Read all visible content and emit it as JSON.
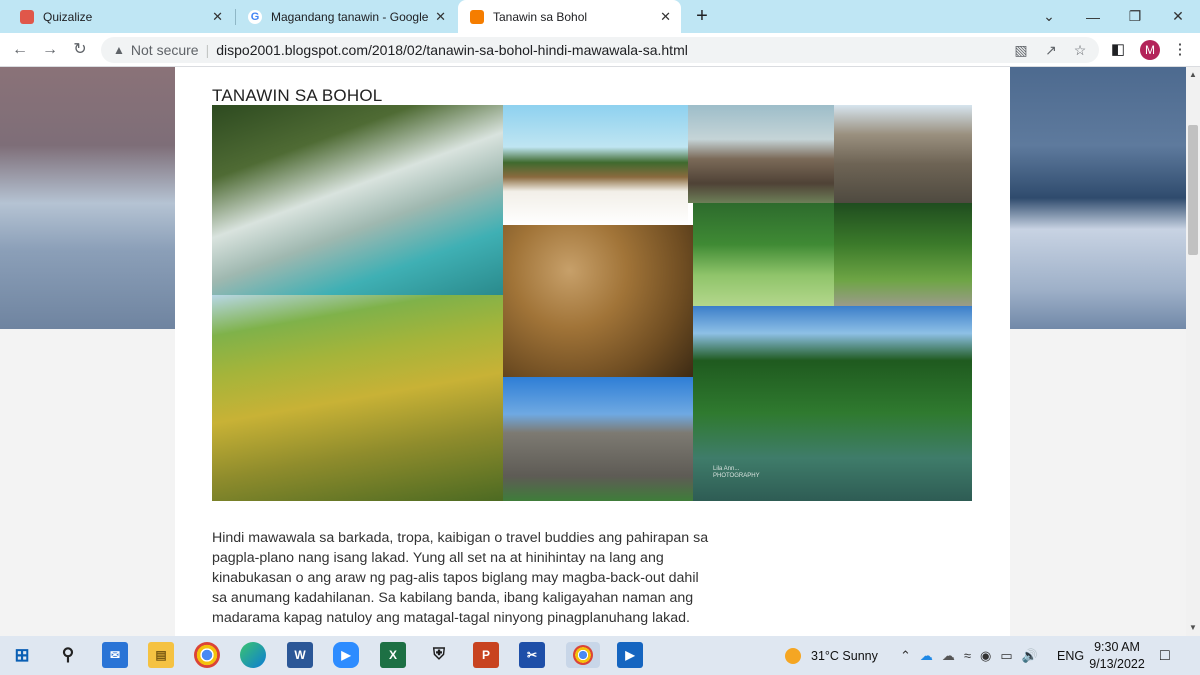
{
  "browser": {
    "tabs": [
      {
        "title": "Quizalize",
        "icon": "quizalize-icon",
        "color": "#e0574a"
      },
      {
        "title": "Magandang tanawin - Google Se",
        "icon": "google-icon",
        "color": "#4285f4"
      },
      {
        "title": "Tanawin sa Bohol",
        "icon": "blogger-icon",
        "color": "#f57d00"
      }
    ],
    "close_glyph": "✕",
    "new_tab_glyph": "+",
    "security_text": "Not secure",
    "url": "dispo2001.blogspot.com/2018/02/tanawin-sa-bohol-hindi-mawawala-sa.html",
    "profile_initial": "M"
  },
  "post": {
    "title": "TANAWIN SA BOHOL",
    "photo_watermark": "Lila Ann...\nPHOTOGRAPHY",
    "body": "Hindi mawawala sa barkada, tropa, kaibigan o travel buddies ang pahirapan sa pagpla-plano nang isang lakad. Yung all set na at hinihintay na lang ang kinabukasan o ang araw ng pag-alis tapos biglang may magba-back-out dahil sa anumang kadahilanan. Sa kabilang banda, ibang kaligayahan naman ang madarama kapag natuloy ang matagal-tagal ninyong pinagplanuhang lakad."
  },
  "taskbar": {
    "apps": [
      "windows-start",
      "search",
      "mail",
      "file-explorer",
      "chrome",
      "edge",
      "word",
      "zoom",
      "excel",
      "defender",
      "powerpoint",
      "snipping",
      "chrome-profile",
      "video"
    ],
    "weather": "31°C  Sunny",
    "language": "ENG",
    "time": "9:30 AM",
    "date": "9/13/2022"
  }
}
